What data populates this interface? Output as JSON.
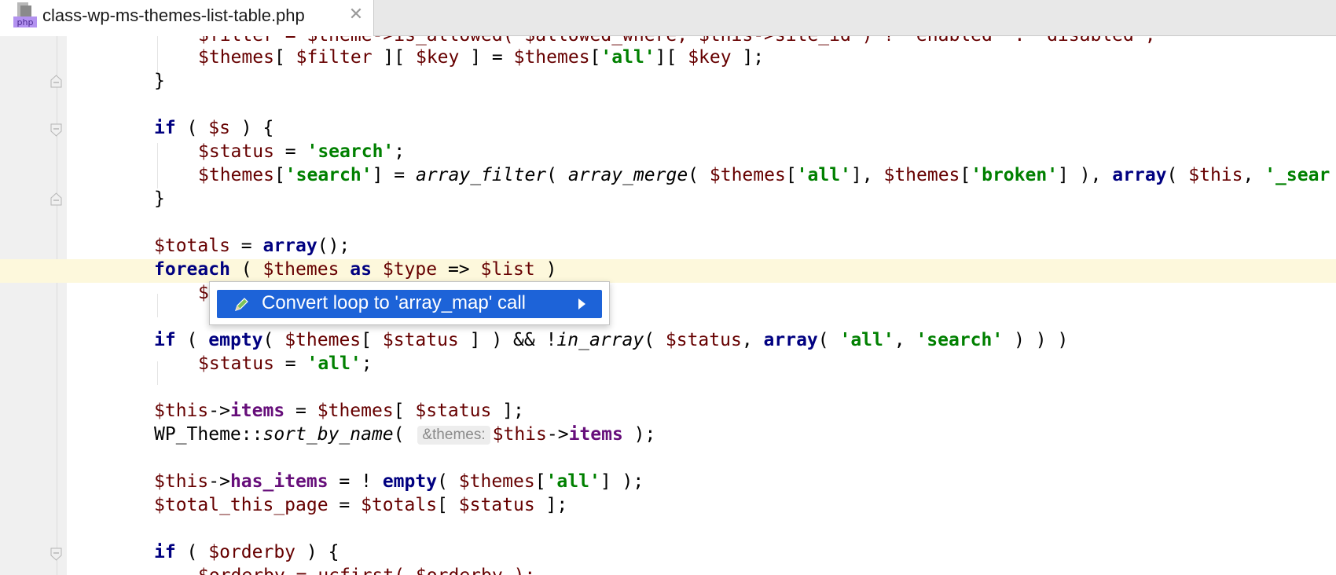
{
  "tab": {
    "file_type": "php",
    "filename": "class-wp-ms-themes-list-table.php",
    "close_glyph": "✕"
  },
  "code": {
    "line_partial_top": "$filter = $theme->is_allowed( $allowed_where, $this->site_id ) ? 'enabled' : 'disabled';",
    "line1": {
      "v1": "$themes",
      "p1": "[ ",
      "v2": "$filter",
      "p2": " ][ ",
      "v3": "$key",
      "p3": " ] = ",
      "v4": "$themes",
      "p4": "[",
      "s1": "'all'",
      "p5": "][ ",
      "v5": "$key",
      "p6": " ];"
    },
    "line2": "}",
    "line3": {
      "k1": "if",
      "p1": " ( ",
      "v1": "$s",
      "p2": " ) {"
    },
    "line4": {
      "v1": "$status",
      "p1": " = ",
      "s1": "'search'",
      "p2": ";"
    },
    "line5": {
      "v1": "$themes",
      "p1": "[",
      "s1": "'search'",
      "p2": "] = ",
      "f1": "array_filter",
      "p3": "( ",
      "f2": "array_merge",
      "p4": "( ",
      "v2": "$themes",
      "p5": "[",
      "s2": "'all'",
      "p6": "], ",
      "v3": "$themes",
      "p7": "[",
      "s3": "'broken'",
      "p8": "] ), ",
      "k1": "array",
      "p9": "( ",
      "v4": "$this",
      "p10": ", ",
      "s4": "'_sear"
    },
    "line6": "}",
    "line7": {
      "v1": "$totals",
      "p1": " = ",
      "k1": "array",
      "p2": "();"
    },
    "line8": {
      "k1": "foreach",
      "p1": " ( ",
      "v1": "$themes",
      "p2": " ",
      "k2": "as",
      "p3": " ",
      "v2": "$type",
      "p4": " => ",
      "v3": "$list",
      "p5": " )"
    },
    "line9": {
      "v1": "$"
    },
    "line10": {
      "k1": "if",
      "p1": " ( ",
      "k2": "empty",
      "p2": "( ",
      "v1": "$themes",
      "p3": "[ ",
      "v2": "$status",
      "p4": " ] ) && !",
      "f1": "in_array",
      "p5": "( ",
      "v3": "$status",
      "p6": ", ",
      "k3": "array",
      "p7": "( ",
      "s1": "'all'",
      "p8": ", ",
      "s2": "'search'",
      "p9": " ) ) )"
    },
    "line11": {
      "v1": "$status",
      "p1": " = ",
      "s1": "'all'",
      "p2": ";"
    },
    "line12": {
      "v1": "$this",
      "p1": "->",
      "pr1": "items",
      "p2": " = ",
      "v2": "$themes",
      "p3": "[ ",
      "v3": "$status",
      "p4": " ];"
    },
    "line13": {
      "c1": "WP_Theme::",
      "f1": "sort_by_name",
      "p1": "( ",
      "hint": "&themes:",
      "v1": "$this",
      "p2": "->",
      "pr1": "items",
      "p3": " );"
    },
    "line14": {
      "v1": "$this",
      "p1": "->",
      "pr1": "has_items",
      "p2": " = ! ",
      "k1": "empty",
      "p3": "( ",
      "v2": "$themes",
      "p4": "[",
      "s1": "'all'",
      "p5": "] );"
    },
    "line15": {
      "v1": "$total_this_page",
      "p1": " = ",
      "v2": "$totals",
      "p2": "[ ",
      "v3": "$status",
      "p3": " ];"
    },
    "line16": {
      "k1": "if",
      "p1": " ( ",
      "v1": "$orderby",
      "p2": " ) {"
    },
    "line17_partial": "$orderby = ucfirst( $orderby );"
  },
  "popup": {
    "label": "Convert loop to 'array_map' call",
    "icon": "pencil-icon",
    "submenu_icon": "submenu-arrow-icon"
  },
  "colors": {
    "keyword": "#000080",
    "variable": "#660000",
    "string": "#008000",
    "property": "#660e7a",
    "selection": "#1d63d8",
    "current_line": "#fdf8dc"
  }
}
